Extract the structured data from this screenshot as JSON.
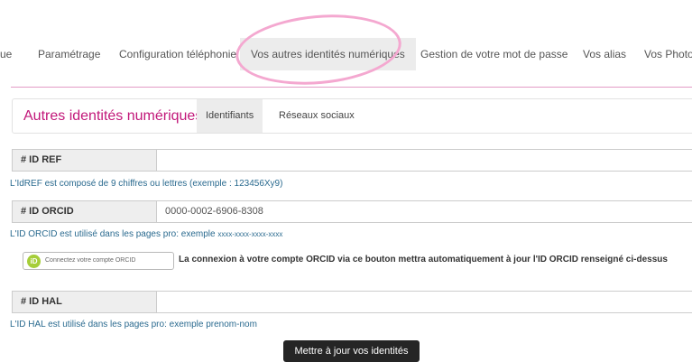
{
  "nav": {
    "items": [
      {
        "label": "ue"
      },
      {
        "label": "Paramétrage"
      },
      {
        "label": "Configuration téléphonie"
      },
      {
        "label": "Vos autres identités numériques"
      },
      {
        "label": "Gestion de votre mot de passe"
      },
      {
        "label": "Vos alias"
      },
      {
        "label": "Vos Photos"
      }
    ],
    "active_index": 3
  },
  "subpanel": {
    "title": "Autres identités numériques",
    "tabs": [
      {
        "label": "Identifiants"
      },
      {
        "label": "Réseaux sociaux"
      }
    ]
  },
  "fields": {
    "idref": {
      "label": "# ID REF",
      "value": "",
      "help": "L'IdREF est composé de 9 chiffres ou lettres (exemple : 123456Xy9)"
    },
    "orcid": {
      "label": "# ID ORCID",
      "value": "0000-0002-6906-8308",
      "help": "L'ID ORCID est utilisé dans les pages pro: exemple",
      "help_example": "xxxx-xxxx-xxxx-xxxx"
    },
    "hal": {
      "label": "# ID HAL",
      "value": "",
      "help": "L'ID HAL est utilisé dans les pages pro: exemple prenom-nom"
    }
  },
  "orcid_connect": {
    "logo_text": "iD",
    "button_label": "Connectez votre compte ORCID",
    "note": "La connexion à votre compte ORCID via ce bouton mettra automatiquement à jour l'ID ORCID renseigné ci-dessus"
  },
  "submit_label": "Mettre à jour vos identités",
  "colors": {
    "accent": "#c2187a",
    "highlight": "#f4a8d0",
    "orcid_green": "#a6ce39",
    "help_text": "#2a6a8f"
  }
}
